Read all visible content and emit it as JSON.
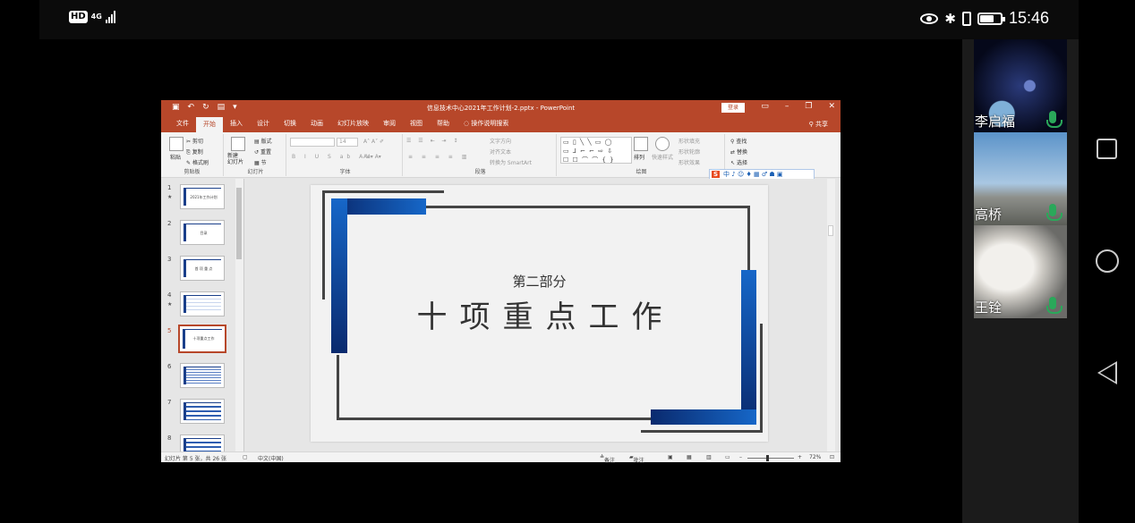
{
  "phone_status": {
    "hd": "HD",
    "network": "4G",
    "time": "15:46"
  },
  "powerpoint": {
    "doc_title": "信息技术中心2021年工作计划-2.pptx  -  PowerPoint",
    "login_label": "登录",
    "share_label": "共享",
    "tabs": [
      "文件",
      "开始",
      "插入",
      "设计",
      "切换",
      "动画",
      "幻灯片放映",
      "审阅",
      "视图",
      "帮助",
      "操作说明搜索"
    ],
    "active_tab": "开始",
    "ribbon": {
      "clipboard": {
        "paste": "粘贴",
        "cut": "剪切",
        "copy": "复制",
        "format_painter": "格式刷",
        "label": "剪贴板"
      },
      "slides": {
        "new_slide": "新建\n幻灯片",
        "layout": "版式",
        "reset": "重置",
        "section": "节",
        "label": "幻灯片"
      },
      "font": {
        "size": "14",
        "label": "字体"
      },
      "paragraph": {
        "text_direction": "文字方向",
        "align_text": "对齐文本",
        "smartart": "转换为 SmartArt",
        "label": "段落"
      },
      "drawing": {
        "arrange": "排列",
        "quick_styles": "快速样式",
        "shape_fill": "形状填充",
        "shape_outline": "形状轮廓",
        "shape_effects": "形状效果",
        "label": "绘图"
      },
      "editing": {
        "find": "查找",
        "replace": "替换",
        "select": "选择"
      }
    },
    "ime_bar": "中 ♪ ☺ ♦ ▦ ♂ ☗ ▣",
    "thumbnails": [
      {
        "num": "1",
        "star": "★",
        "text": "2021年工作计划"
      },
      {
        "num": "2",
        "star": "",
        "text": "目录"
      },
      {
        "num": "3",
        "star": "",
        "text": "首 项 重 点"
      },
      {
        "num": "4",
        "star": "★",
        "text": ""
      },
      {
        "num": "5",
        "star": "",
        "text": "十项重点工作"
      },
      {
        "num": "6",
        "star": "",
        "text": ""
      },
      {
        "num": "7",
        "star": "",
        "text": ""
      },
      {
        "num": "8",
        "star": "",
        "text": ""
      }
    ],
    "selected_slide": 5,
    "slide": {
      "subtitle": "第二部分",
      "title": "十项重点工作"
    },
    "status": {
      "slide_info": "幻灯片 第 5 张，共 26 张",
      "language": "中文(中国)",
      "notes": "备注",
      "comments": "批注",
      "zoom": "72%"
    }
  },
  "participants": [
    {
      "name": "李启福"
    },
    {
      "name": "高桥"
    },
    {
      "name": "王铨"
    }
  ]
}
